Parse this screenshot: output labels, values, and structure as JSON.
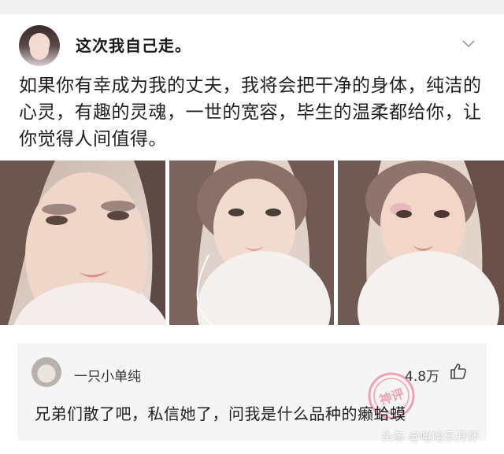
{
  "post": {
    "username": "这次我自己走。",
    "text": "如果你有幸成为我的丈夫，我将会把干净的身体，纯洁的心灵，有趣的灵魂，一世的宽容，毕生的温柔都给你，让你觉得人间值得。",
    "photo_count": 3
  },
  "comment": {
    "username": "一只小单纯",
    "likes": "4.8万",
    "text": "兄弟们散了吧，私信她了，问我是什么品种的癞蛤蟆",
    "stamp_label": "神评"
  },
  "watermark": "头条 @哈哈乐开怀",
  "icons": {
    "header_menu": "chevron-down-icon",
    "like": "thumbs-up-icon"
  },
  "colors": {
    "card_bg": "#f5f5f5",
    "stamp": "#e8607a"
  }
}
